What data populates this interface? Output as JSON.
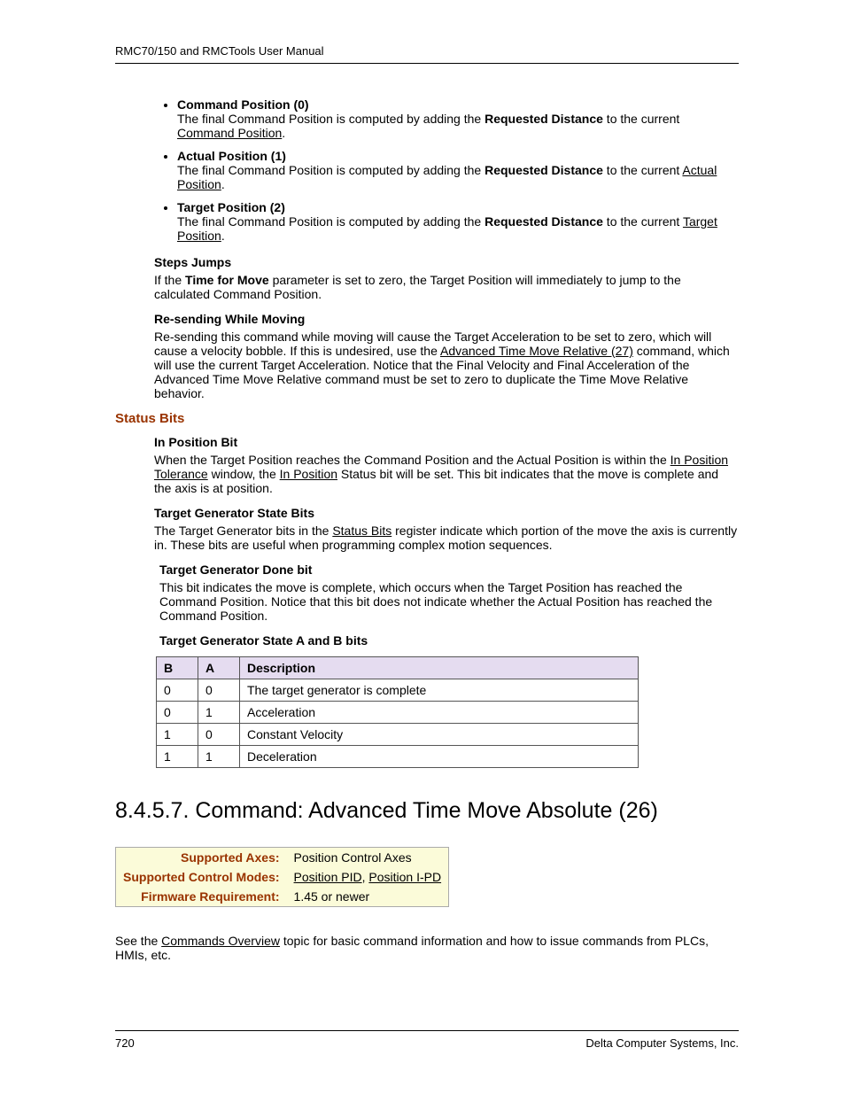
{
  "header": "RMC70/150 and RMCTools User Manual",
  "bullets": [
    {
      "title": "Command Position (0)",
      "pre": "The final Command Position is computed by adding the ",
      "bold": "Requested Distance",
      "mid": " to the current ",
      "link": "Command Position",
      "post": "."
    },
    {
      "title": "Actual Position (1)",
      "pre": "The final Command Position is computed by adding the ",
      "bold": "Requested Distance",
      "mid": " to the current ",
      "link": "Actual Position",
      "post": "."
    },
    {
      "title": "Target Position (2)",
      "pre": "The final Command Position is computed by adding the ",
      "bold": "Requested Distance",
      "mid": " to the current ",
      "link": "Target Position",
      "post": "."
    }
  ],
  "stepsJumps": {
    "title": "Steps Jumps",
    "text1": "If the ",
    "bold1": "Time  for Move",
    "text2": " parameter is set to zero, the Target Position will immediately to jump to the calculated Command Position."
  },
  "resend": {
    "title": "Re-sending While Moving",
    "text1": "Re-sending this command while moving will cause the Target Acceleration to be set to zero, which will cause a velocity bobble. If this is undesired, use the ",
    "link": "Advanced Time Move Relative (27)",
    "text2": " command, which will use the current Target Acceleration. Notice that the Final Velocity and Final Acceleration of the Advanced Time Move Relative command must be set to zero to duplicate the Time Move Relative behavior."
  },
  "statusBits": {
    "heading": "Status Bits",
    "inPos": {
      "title": "In Position Bit",
      "t1": "When the Target Position reaches the Command Position and the Actual Position is within the ",
      "l1": "In Position Tolerance",
      "t2": " window, the ",
      "l2": "In Position",
      "t3": " Status bit will be set. This bit indicates that the move is complete and the axis is at position."
    },
    "tgState": {
      "title": "Target Generator State Bits",
      "t1": "The Target Generator bits in the ",
      "l1": "Status Bits",
      "t2": " register indicate which portion of the move the axis is currently in. These bits are useful when programming complex motion sequences."
    },
    "tgDone": {
      "title": "Target Generator Done bit",
      "text": "This bit indicates the move is complete, which occurs when the Target Position has reached the Command Position. Notice that this bit does not indicate whether the Actual Position has reached the Command Position."
    },
    "tgAB": {
      "title": "Target Generator State A and B bits"
    }
  },
  "table": {
    "headers": {
      "b": "B",
      "a": "A",
      "desc": "Description"
    },
    "rows": [
      {
        "b": "0",
        "a": "0",
        "desc": "The target generator is complete"
      },
      {
        "b": "0",
        "a": "1",
        "desc": "Acceleration"
      },
      {
        "b": "1",
        "a": "0",
        "desc": "Constant Velocity"
      },
      {
        "b": "1",
        "a": "1",
        "desc": "Deceleration"
      }
    ]
  },
  "chapter": "8.4.5.7. Command: Advanced Time Move Absolute (26)",
  "infobox": {
    "axesLabel": "Supported Axes:",
    "axesVal": "Position Control Axes",
    "modesLabel": "Supported Control Modes:",
    "modesLink1": "Position PID",
    "modesSep": ", ",
    "modesLink2": "Position I-PD",
    "fwLabel": "Firmware Requirement:",
    "fwVal": "1.45 or newer"
  },
  "seeAlso": {
    "t1": "See the ",
    "link": "Commands Overview",
    "t2": " topic for basic command information and how to issue commands from PLCs, HMIs, etc."
  },
  "footer": {
    "page": "720",
    "company": "Delta Computer Systems, Inc."
  }
}
